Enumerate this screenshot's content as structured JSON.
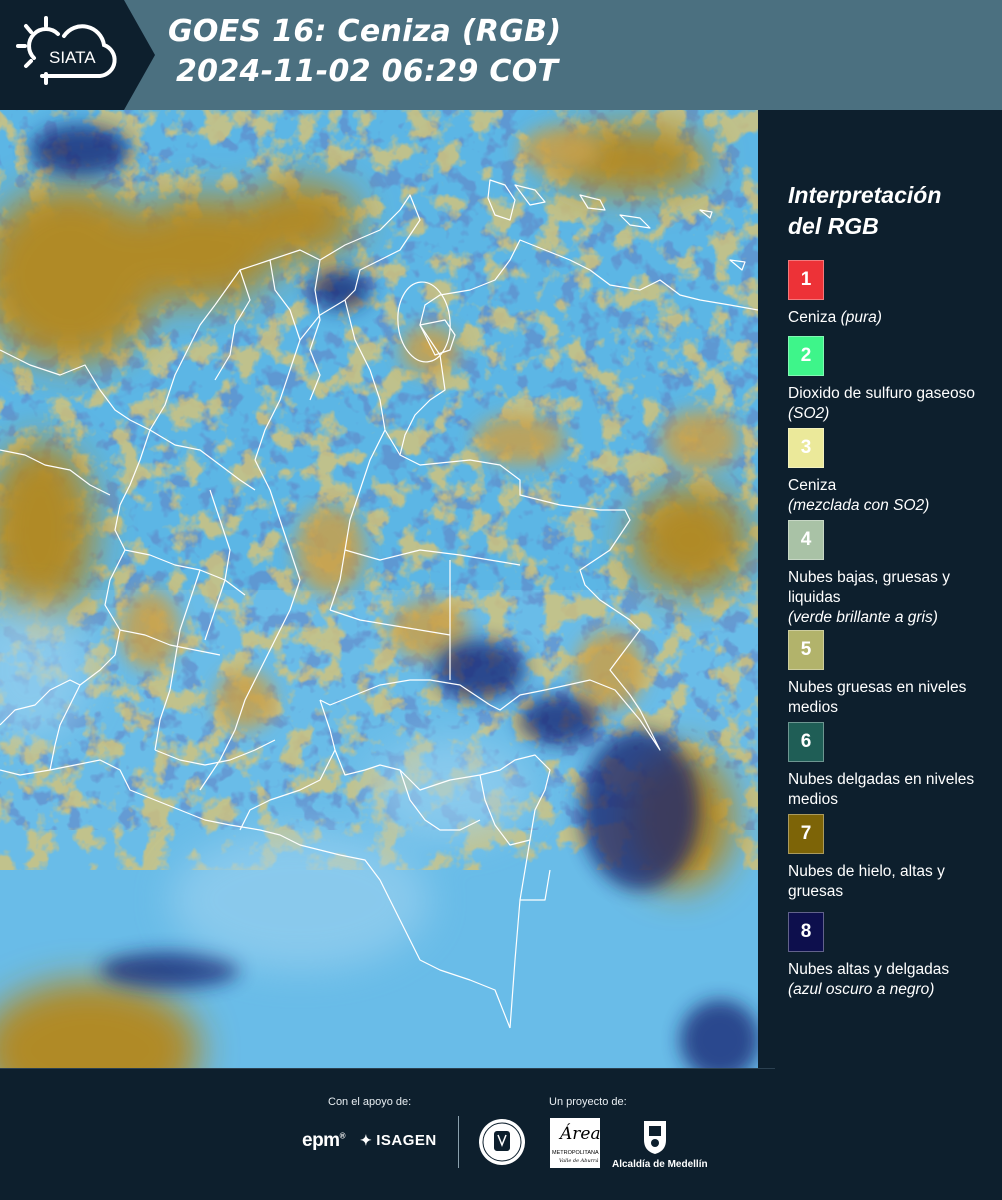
{
  "header": {
    "logo_text": "SIATA",
    "title": "GOES 16: Ceniza (RGB)",
    "datetime": "2024-11-02 06:29 COT"
  },
  "legend": {
    "title_line1": "Interpretación",
    "title_line2": "del RGB",
    "items": [
      {
        "number": "1",
        "color": "#ed3237",
        "text": "Ceniza",
        "note": "(pura)"
      },
      {
        "number": "2",
        "color": "#3ef58a",
        "text": "Dioxido de sulfuro gaseoso",
        "note": "(SO2)"
      },
      {
        "number": "3",
        "color": "#ebe99a",
        "text": "Ceniza",
        "note": "(mezclada con SO2)"
      },
      {
        "number": "4",
        "color": "#a9c2a6",
        "text": "Nubes bajas, gruesas y liquidas",
        "note": "(verde brillante a gris)"
      },
      {
        "number": "5",
        "color": "#b2b36b",
        "text": "Nubes gruesas en niveles medios",
        "note": ""
      },
      {
        "number": "6",
        "color": "#1f5e56",
        "text": "Nubes delgadas en niveles medios",
        "note": ""
      },
      {
        "number": "7",
        "color": "#7d6407",
        "text": "Nubes de hielo, altas y gruesas",
        "note": ""
      },
      {
        "number": "8",
        "color": "#0d0f4d",
        "text": "Nubes altas y delgadas",
        "note": "(azul oscuro a negro)"
      }
    ]
  },
  "footer": {
    "support_label": "Con el apoyo de:",
    "project_label": "Un proyecto de:",
    "sponsor_epm": "epm",
    "sponsor_isagen": "ISAGEN",
    "partner_area_word": "Área",
    "partner_area_line1": "METROPOLITANA",
    "partner_area_line2": "Valle de Aburrá",
    "partner_alcaldia": "Alcaldía de Medellín"
  },
  "colors": {
    "background": "#0d1f2d",
    "header": "#4b7080",
    "map_base": "#5eb7e4",
    "cloud_ochre": "#b08d2e",
    "cloud_dark_blue": "#14206a"
  }
}
